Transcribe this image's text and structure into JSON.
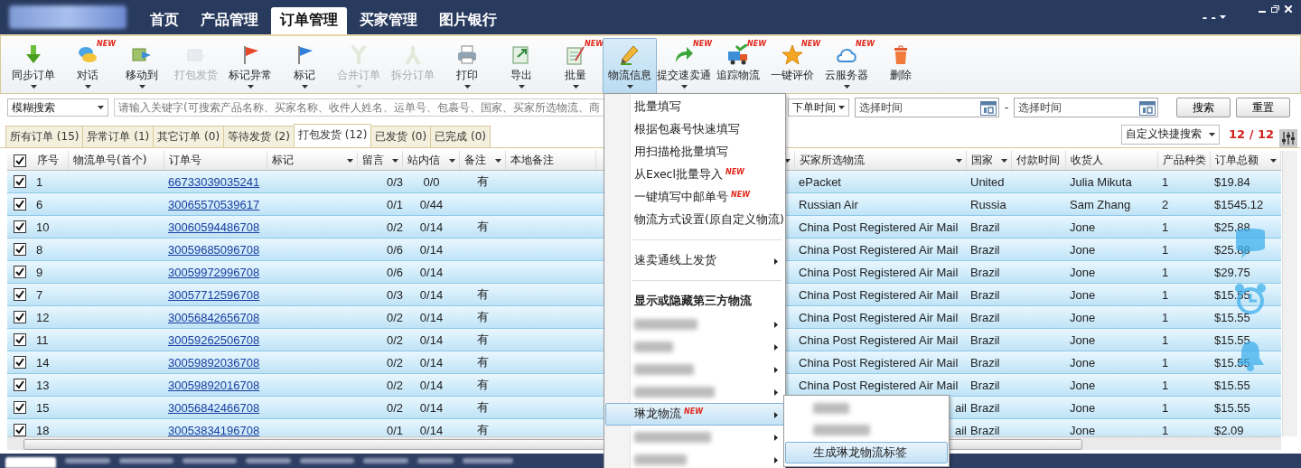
{
  "header": {
    "tabs": [
      {
        "label": "首页",
        "selected": false
      },
      {
        "label": "产品管理",
        "selected": false
      },
      {
        "label": "订单管理",
        "selected": true
      },
      {
        "label": "买家管理",
        "selected": false
      },
      {
        "label": "图片银行",
        "selected": false
      }
    ],
    "account": "- -"
  },
  "toolbar": [
    {
      "label": "同步订单",
      "dropdown": true,
      "disabled": false,
      "selected": false
    },
    {
      "label": "对话",
      "dropdown": true,
      "disabled": false,
      "selected": false,
      "badge": "NEW"
    },
    {
      "label": "移动到",
      "dropdown": true,
      "disabled": false,
      "selected": false
    },
    {
      "label": "打包发货",
      "dropdown": false,
      "disabled": true,
      "selected": false
    },
    {
      "label": "标记异常",
      "dropdown": true,
      "disabled": false,
      "selected": false
    },
    {
      "label": "标记",
      "dropdown": true,
      "disabled": false,
      "selected": false
    },
    {
      "label": "合并订单",
      "dropdown": true,
      "disabled": true,
      "selected": false
    },
    {
      "label": "拆分订单",
      "dropdown": false,
      "disabled": true,
      "selected": false
    },
    {
      "label": "打印",
      "dropdown": true,
      "disabled": false,
      "selected": false
    },
    {
      "label": "导出",
      "dropdown": true,
      "disabled": false,
      "selected": false
    },
    {
      "label": "批量",
      "dropdown": true,
      "disabled": false,
      "selected": false,
      "badge": "NEW"
    },
    {
      "label": "物流信息",
      "dropdown": true,
      "disabled": false,
      "selected": true
    },
    {
      "label": "提交速卖通",
      "dropdown": true,
      "disabled": false,
      "selected": false,
      "badge": "NEW"
    },
    {
      "label": "追踪物流",
      "dropdown": false,
      "disabled": false,
      "selected": false,
      "badge": "NEW"
    },
    {
      "label": "一键评价",
      "dropdown": false,
      "disabled": false,
      "selected": false,
      "badge": "NEW"
    },
    {
      "label": "云服务器",
      "dropdown": true,
      "disabled": false,
      "selected": false,
      "badge": "NEW"
    },
    {
      "label": "删除",
      "dropdown": false,
      "disabled": false,
      "selected": false
    }
  ],
  "filter": {
    "search_mode": "模糊搜索",
    "keyword_placeholder": "请输入关键字(可搜索产品名称、买家名称、收件人姓名、运单号、包裹号、国家、买家所选物流、商",
    "time_field": "下单时间",
    "start_placeholder": "选择时间",
    "separator": "-",
    "end_placeholder": "选择时间",
    "buttons": [
      "搜索",
      "重置"
    ]
  },
  "order_tabs": [
    {
      "label": "所有订单 (15)",
      "selected": false
    },
    {
      "label": "异常订单 (1)",
      "selected": false
    },
    {
      "label": "其它订单 (0)",
      "selected": false
    },
    {
      "label": "等待发货 (2)",
      "selected": false
    },
    {
      "label": "打包发货 (12)",
      "selected": true
    },
    {
      "label": "已发货 (0)",
      "selected": false
    },
    {
      "label": "已完成 (0)",
      "selected": false
    }
  ],
  "quick_search": "自定义快捷搜索",
  "page_count": "12 / 12",
  "table": {
    "all_checked": true,
    "columns": [
      {
        "label": "序号",
        "filter": false
      },
      {
        "label": "物流单号(首个)",
        "filter": false
      },
      {
        "label": "订单号",
        "filter": false
      },
      {
        "label": "标记",
        "filter": true
      },
      {
        "label": "留言",
        "filter": true
      },
      {
        "label": "站内信",
        "filter": true
      },
      {
        "label": "备注",
        "filter": true
      },
      {
        "label": "本地备注",
        "filter": false
      },
      {
        "label": "买家所选物流",
        "filter": true
      },
      {
        "label": "国家",
        "filter": true
      },
      {
        "label": "付款时间",
        "filter": false
      },
      {
        "label": "收货人",
        "filter": false
      },
      {
        "label": "产品种类",
        "filter": false
      },
      {
        "label": "订单总额",
        "filter": true
      }
    ],
    "rows": [
      {
        "checked": true,
        "no": "1",
        "order": "66733039035241",
        "messages": "0/3",
        "inbox": "0/0",
        "note": "有",
        "shipping": "ePacket",
        "country": "United",
        "buyer": "Julia Mikuta",
        "items": "1",
        "total": "$19.84"
      },
      {
        "checked": true,
        "no": "6",
        "order": "30065570539617",
        "messages": "0/1",
        "inbox": "0/44",
        "shipping": "Russian Air",
        "country": "Russia",
        "buyer": "Sam Zhang",
        "items": "2",
        "total": "$1545.12"
      },
      {
        "checked": true,
        "no": "10",
        "order": "30060594486708",
        "messages": "0/2",
        "inbox": "0/14",
        "note": "有",
        "shipping": "China Post Registered Air Mail",
        "country": "Brazil",
        "buyer": "Jone",
        "items": "1",
        "total": "$25.88"
      },
      {
        "checked": true,
        "no": "8",
        "order": "30059685096708",
        "messages": "0/6",
        "inbox": "0/14",
        "shipping": "China Post Registered Air Mail",
        "country": "Brazil",
        "buyer": "Jone",
        "items": "1",
        "total": "$25.88"
      },
      {
        "checked": true,
        "no": "9",
        "order": "30059972996708",
        "messages": "0/6",
        "inbox": "0/14",
        "shipping": "China Post Registered Air Mail",
        "country": "Brazil",
        "buyer": "Jone",
        "items": "1",
        "total": "$29.75"
      },
      {
        "checked": true,
        "no": "7",
        "order": "30057712596708",
        "messages": "0/3",
        "inbox": "0/14",
        "note": "有",
        "shipping": "China Post Registered Air Mail",
        "country": "Brazil",
        "buyer": "Jone",
        "items": "1",
        "total": "$15.55"
      },
      {
        "checked": true,
        "no": "12",
        "order": "30056842656708",
        "messages": "0/2",
        "inbox": "0/14",
        "note": "有",
        "shipping": "China Post Registered Air Mail",
        "country": "Brazil",
        "buyer": "Jone",
        "items": "1",
        "total": "$15.55"
      },
      {
        "checked": true,
        "no": "11",
        "order": "30059262506708",
        "messages": "0/2",
        "inbox": "0/14",
        "note": "有",
        "shipping": "China Post Registered Air Mail",
        "country": "Brazil",
        "buyer": "Jone",
        "items": "1",
        "total": "$15.55"
      },
      {
        "checked": true,
        "no": "14",
        "order": "30059892036708",
        "messages": "0/2",
        "inbox": "0/14",
        "note": "有",
        "shipping": "China Post Registered Air Mail",
        "country": "Brazil",
        "buyer": "Jone",
        "items": "1",
        "total": "$15.55"
      },
      {
        "checked": true,
        "no": "13",
        "order": "30059892016708",
        "messages": "0/2",
        "inbox": "0/14",
        "note": "有",
        "shipping": "China Post Registered Air Mail",
        "country": "Brazil",
        "buyer": "Jone",
        "items": "1",
        "total": "$15.55"
      },
      {
        "checked": true,
        "no": "15",
        "order": "30056842466708",
        "messages": "0/2",
        "inbox": "0/14",
        "note": "有",
        "shipping": "ail",
        "shipping_partial": true,
        "country": "Brazil",
        "buyer": "Jone",
        "items": "1",
        "total": "$15.55"
      },
      {
        "checked": true,
        "no": "18",
        "order": "30053834196708",
        "messages": "0/1",
        "inbox": "0/14",
        "note": "有",
        "shipping": "ail",
        "shipping_partial": true,
        "country": "Brazil",
        "buyer": "Jone",
        "items": "1",
        "total": "$2.09"
      }
    ]
  },
  "logistics_menu": {
    "items": [
      {
        "kind": "item",
        "label": "批量填写",
        "selected": false
      },
      {
        "kind": "item",
        "label": "根据包裹号快速填写",
        "selected": false
      },
      {
        "kind": "item",
        "label": "用扫描枪批量填写",
        "selected": false
      },
      {
        "kind": "item",
        "label": "从Execl批量导入",
        "badge": "NEW",
        "selected": false
      },
      {
        "kind": "item",
        "label": "一键填写中邮单号",
        "badge": "NEW",
        "selected": false
      },
      {
        "kind": "item",
        "label": "物流方式设置(原自定义物流)",
        "selected": false
      },
      {
        "kind": "separator"
      },
      {
        "kind": "submenu",
        "label": "速卖通线上发货",
        "selected": false
      },
      {
        "kind": "separator"
      },
      {
        "kind": "header",
        "label": "显示或隐藏第三方物流"
      },
      {
        "kind": "blurred",
        "selected": false
      },
      {
        "kind": "blurred",
        "selected": false
      },
      {
        "kind": "blurred",
        "selected": false
      },
      {
        "kind": "blurred",
        "selected": false
      },
      {
        "kind": "submenu",
        "label": "琳龙物流",
        "badge": "NEW",
        "selected": true
      },
      {
        "kind": "blurred",
        "selected": false
      },
      {
        "kind": "blurred",
        "selected": false
      }
    ],
    "submenu": [
      {
        "kind": "blurred",
        "selected": false
      },
      {
        "kind": "blurred",
        "selected": false
      },
      {
        "kind": "item",
        "label": "生成琳龙物流标签",
        "selected": true
      }
    ]
  }
}
